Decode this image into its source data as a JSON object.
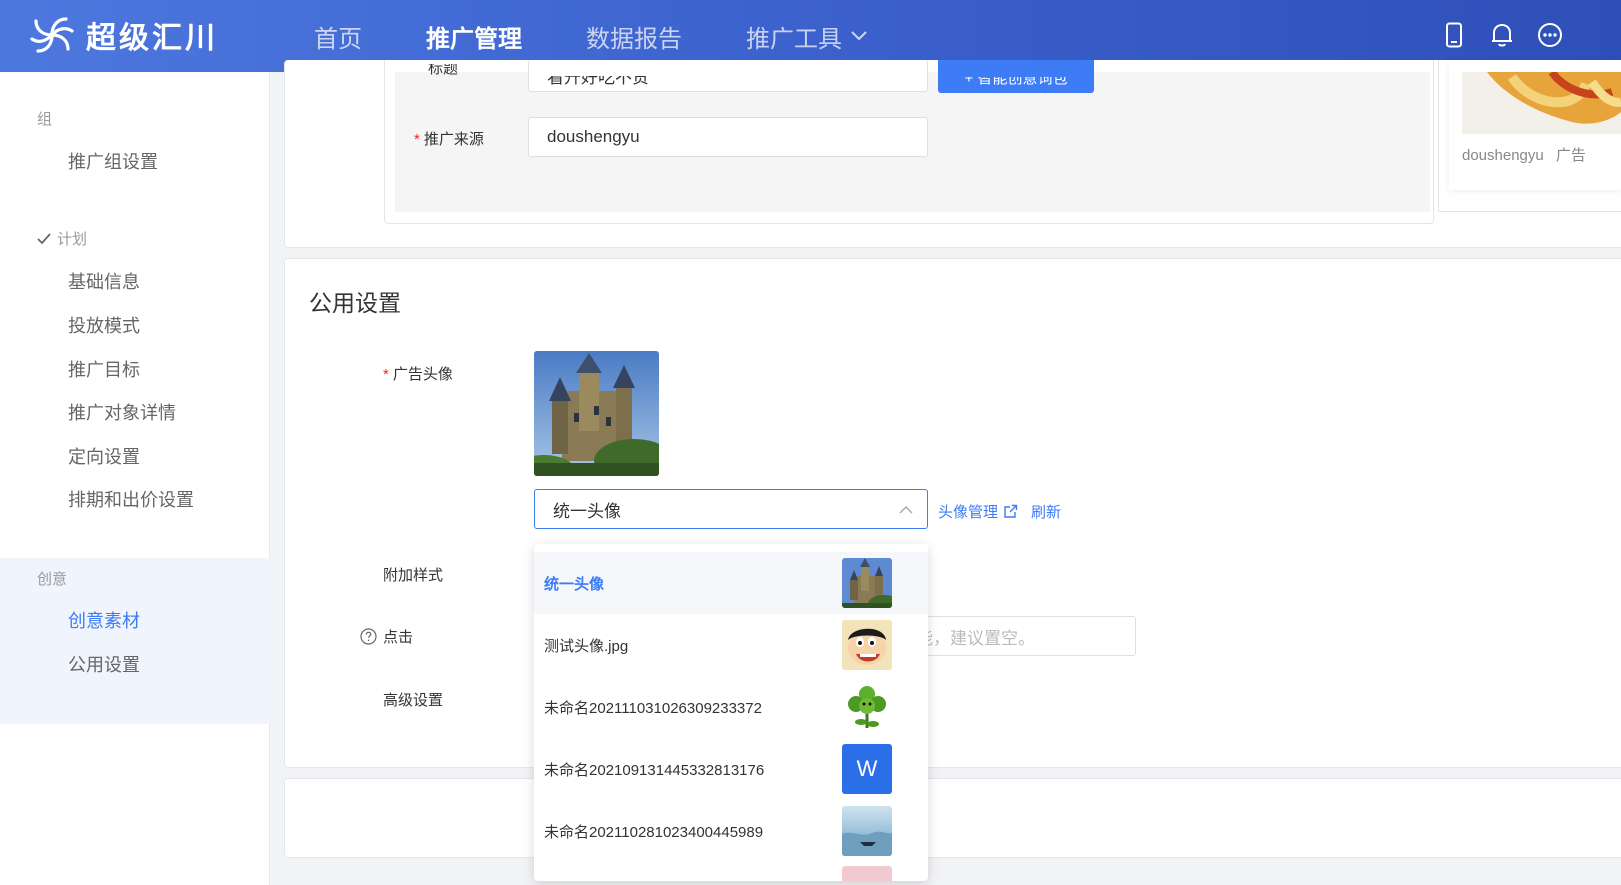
{
  "app": {
    "name": "超级汇川"
  },
  "nav": {
    "items": [
      {
        "label": "首页",
        "active": false
      },
      {
        "label": "推广管理",
        "active": true
      },
      {
        "label": "数据报告",
        "active": false
      },
      {
        "label": "推广工具",
        "active": false,
        "has_dropdown": true
      }
    ],
    "icons": [
      "mobile-icon",
      "bell-icon",
      "more-icon"
    ]
  },
  "sidebar": {
    "group_title": "组",
    "group_items": [
      "推广组设置"
    ],
    "plan_title": "计划",
    "plan_items": [
      "基础信息",
      "投放模式",
      "推广目标",
      "推广对象详情",
      "定向设置",
      "排期和出价设置"
    ],
    "creative_title": "创意",
    "creative_items": [
      "创意素材",
      "公用设置"
    ],
    "active_item": "创意素材"
  },
  "top_form": {
    "title_label": "标题",
    "title_value": "看升好吃不贵",
    "smart_button": "+ 智能创意词包",
    "source_label": "推广来源",
    "source_value": "doushengyu",
    "preview_name": "doushengyu",
    "preview_ad": "广告"
  },
  "common_settings": {
    "section_title": "公用设置",
    "avatar_label": "广告头像",
    "avatar_select_value": "统一头像",
    "avatar_manage_link": "头像管理",
    "refresh_link": "刷新",
    "extra_style_label": "附加样式",
    "click_label": "点击",
    "click_placeholder_tail": "能，建议置空。",
    "advanced_label": "高级设置"
  },
  "avatar_dropdown": {
    "options": [
      {
        "label": "统一头像",
        "thumb": "castle",
        "selected": true
      },
      {
        "label": "测试头像.jpg",
        "thumb": "cartoon",
        "selected": false
      },
      {
        "label": "未命名20211103102630923337​2",
        "thumb": "plant",
        "selected": false
      },
      {
        "label": "未命名20210913144533281317​6",
        "thumb": "w-letter",
        "selected": false
      },
      {
        "label": "未命名20211028102340044598​9",
        "thumb": "sea",
        "selected": false
      }
    ],
    "w_letter": "W"
  },
  "colors": {
    "accent": "#3d7cf5",
    "nav_start": "#4d78de",
    "nav_end": "#2f4fb8",
    "required": "#f5222d"
  }
}
